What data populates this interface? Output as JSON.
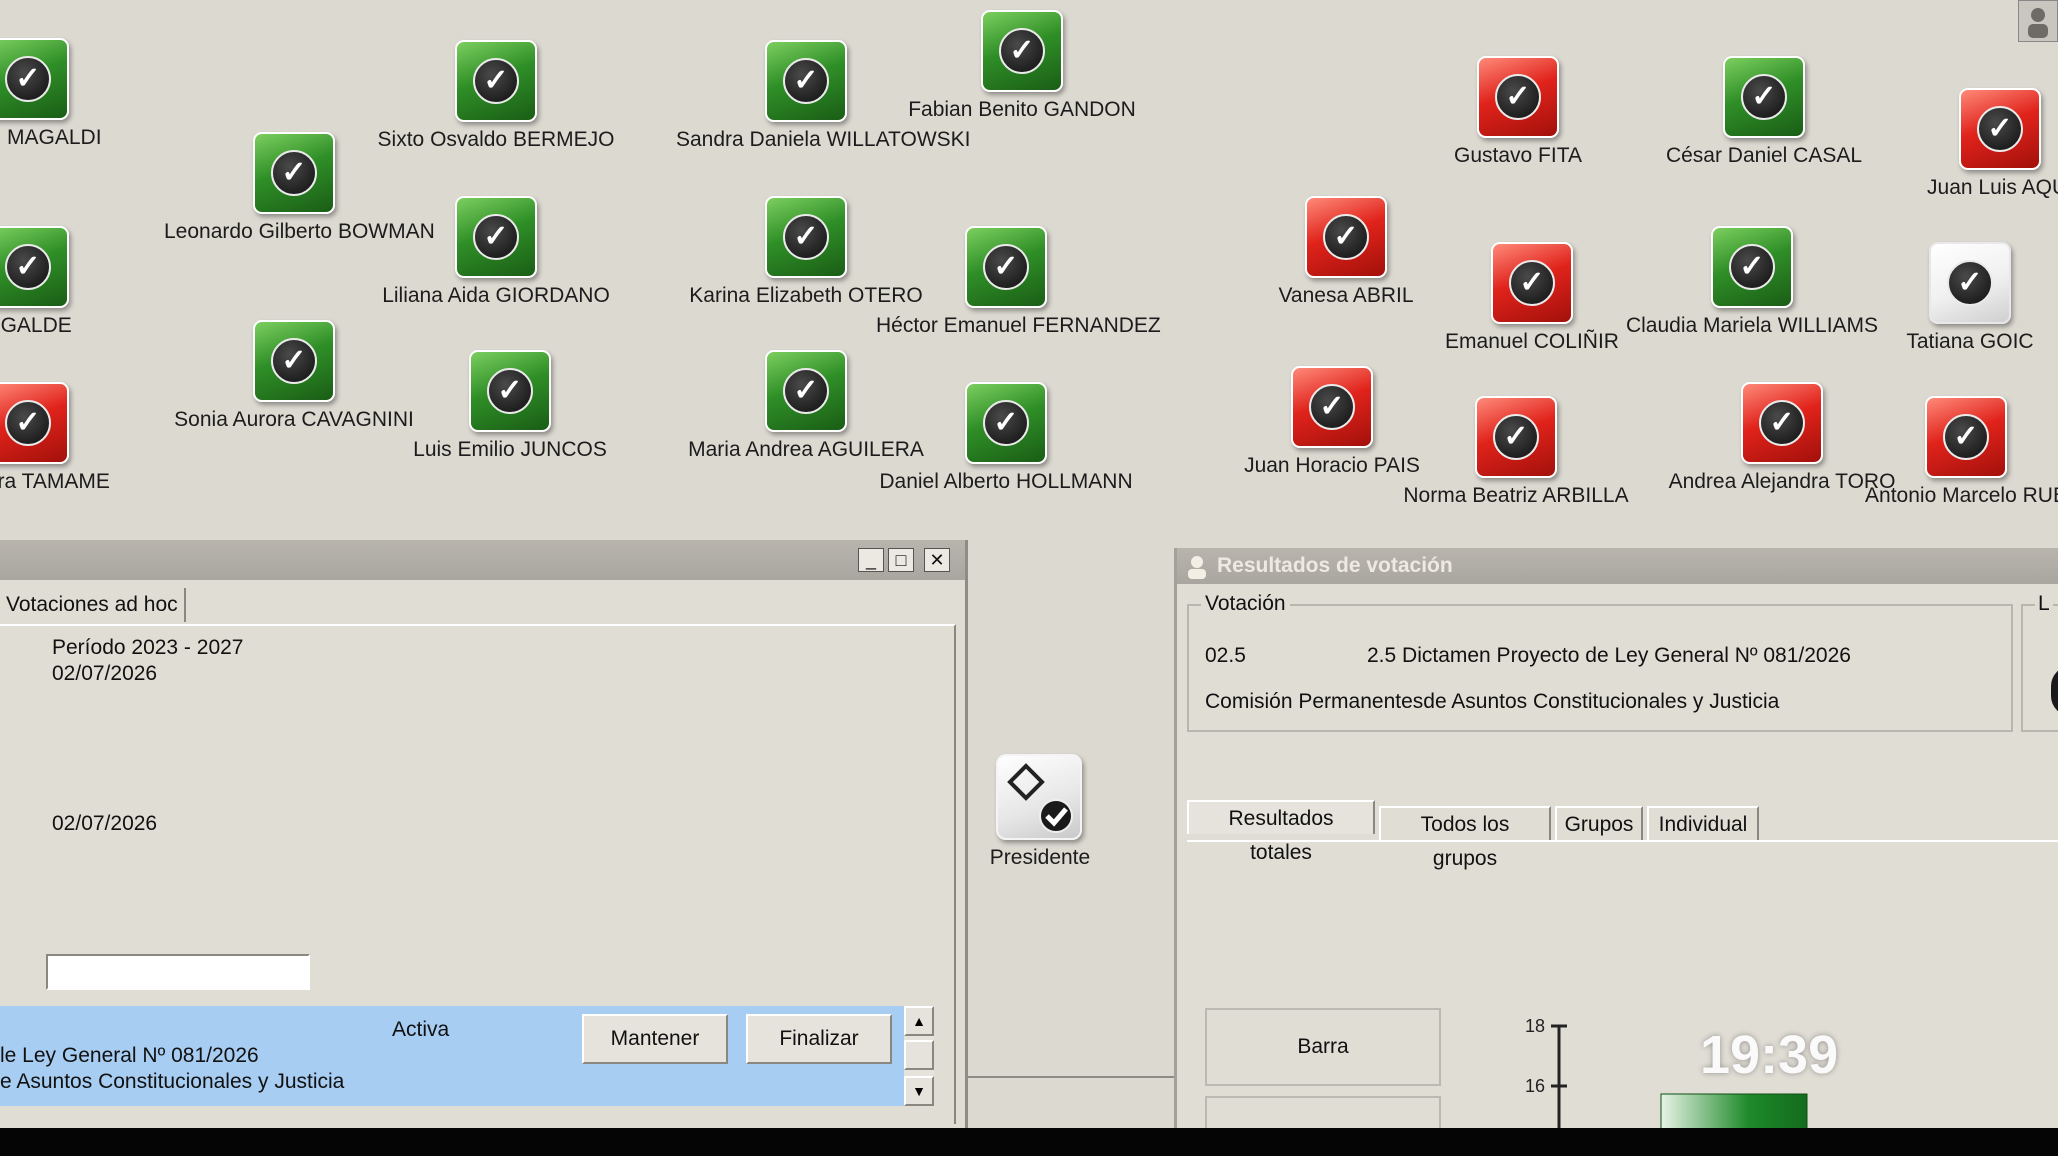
{
  "voters": [
    {
      "name": "edad MAGALDI",
      "color": "green"
    },
    {
      "name": "Leonardo Gilberto BOWMAN",
      "color": "green"
    },
    {
      "name": "Sixto Osvaldo BERMEJO",
      "color": "green"
    },
    {
      "name": "Sandra Daniela WILLATOWSKI",
      "color": "green"
    },
    {
      "name": "Fabian Benito GANDON",
      "color": "green"
    },
    {
      "name": "OGALDE",
      "color": "green"
    },
    {
      "name": "Liliana Aida GIORDANO",
      "color": "green"
    },
    {
      "name": "Karina Elizabeth OTERO",
      "color": "green"
    },
    {
      "name": "Héctor Emanuel FERNANDEZ",
      "color": "green"
    },
    {
      "name": "ejandra TAMAME",
      "color": "red"
    },
    {
      "name": "Sonia Aurora CAVAGNINI",
      "color": "green"
    },
    {
      "name": "Luis Emilio JUNCOS",
      "color": "green"
    },
    {
      "name": "Maria Andrea AGUILERA",
      "color": "green"
    },
    {
      "name": "Daniel Alberto  HOLLMANN",
      "color": "green"
    },
    {
      "name": "Gustavo FITA",
      "color": "red"
    },
    {
      "name": "César Daniel CASAL",
      "color": "green"
    },
    {
      "name": "Juan Luis AQUI",
      "color": "red"
    },
    {
      "name": "Vanesa ABRIL",
      "color": "red"
    },
    {
      "name": "Emanuel COLIÑIR",
      "color": "red"
    },
    {
      "name": "Claudia Mariela WILLIAMS",
      "color": "green"
    },
    {
      "name": "Tatiana GOIC",
      "color": "white"
    },
    {
      "name": "Juan Horacio PAIS",
      "color": "red"
    },
    {
      "name": "Norma Beatriz ARBILLA",
      "color": "red"
    },
    {
      "name": "Andrea Alejandra TORO",
      "color": "red"
    },
    {
      "name": "Antonio Marcelo RUB",
      "color": "red"
    }
  ],
  "presidente": {
    "label": "Presidente"
  },
  "left_window": {
    "tab": "Votaciones ad hoc",
    "periodo": "Período 2023 - 2027",
    "date1": "02/07/2026",
    "date2": "02/07/2026",
    "input_value": "",
    "row": {
      "status": "Activa",
      "line1": "le Ley General Nº 081/2026",
      "line2": "e Asuntos Constitucionales y Justicia",
      "btn_keep": "Mantener",
      "btn_end": "Finalizar"
    }
  },
  "results_window": {
    "title": "Resultados de votación",
    "group_label": "Votación",
    "number": "02.5",
    "description": "2.5 Dictamen Proyecto de Ley General Nº 081/2026",
    "commission": "Comisión Permanentesde Asuntos Constitucionales y Justicia",
    "right_group_label": "L",
    "tabs": [
      "Resultados totales",
      "Todos los grupos",
      "Grupos",
      "Individual"
    ],
    "chart_button": "Barra"
  },
  "chart_data": {
    "type": "bar",
    "y_ticks": [
      "18",
      "16"
    ],
    "visible_bar_color": "#1e8a2a"
  },
  "clock": "19:39"
}
